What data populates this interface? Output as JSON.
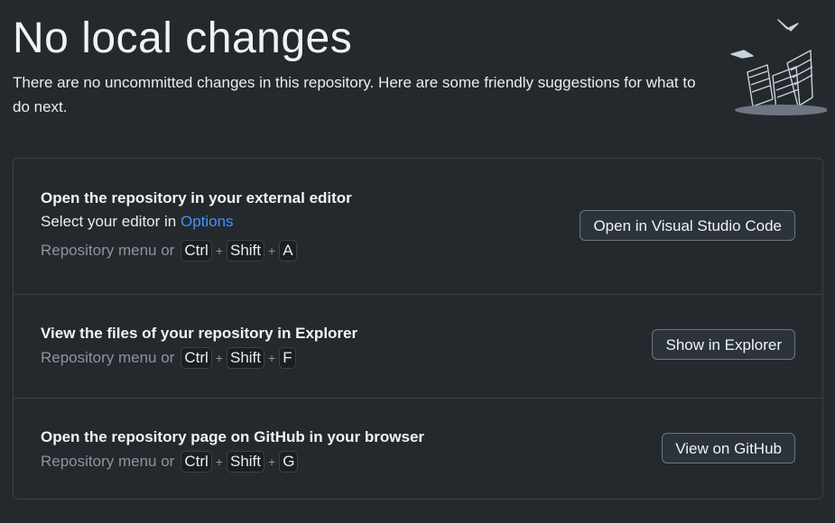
{
  "header": {
    "title": "No local changes",
    "subtitle": "There are no uncommitted changes in this repository. Here are some friendly suggestions for what to do next."
  },
  "suggestions": [
    {
      "title": "Open the repository in your external editor",
      "description_prefix": "Select your editor in ",
      "description_link": "Options",
      "shortcut_prefix": "Repository menu or",
      "keys": [
        "Ctrl",
        "Shift",
        "A"
      ],
      "button_label": "Open in Visual Studio Code"
    },
    {
      "title": "View the files of your repository in Explorer",
      "shortcut_prefix": "Repository menu or",
      "keys": [
        "Ctrl",
        "Shift",
        "F"
      ],
      "button_label": "Show in Explorer"
    },
    {
      "title": "Open the repository page on GitHub in your browser",
      "shortcut_prefix": "Repository menu or",
      "keys": [
        "Ctrl",
        "Shift",
        "G"
      ],
      "button_label": "View on GitHub"
    }
  ],
  "shortcut_separator": "+",
  "colors": {
    "background": "#24292e",
    "link": "#4493f8",
    "border": "#3b4148"
  },
  "icons": [
    "paper-pile-illustration-icon"
  ]
}
